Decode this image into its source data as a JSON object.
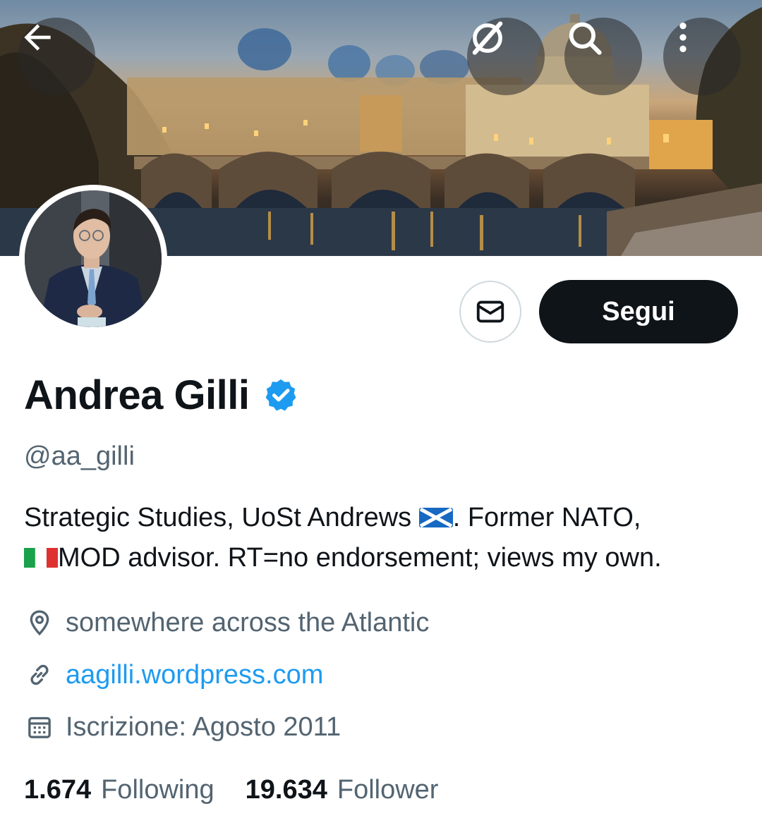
{
  "header": {
    "back_icon": "arrow-left-icon",
    "grok_icon": "slashed-circle-icon",
    "search_icon": "search-icon",
    "more_icon": "more-vertical-icon"
  },
  "profile": {
    "display_name": "Andrea Gilli",
    "verified": true,
    "handle": "@aa_gilli",
    "bio_part1": "Strategic Studies, UoSt Andrews ",
    "bio_part2": ". Former NATO,",
    "bio_part3": "MOD advisor. RT=no endorsement; views my own.",
    "location": "somewhere across the Atlantic",
    "website": "aagilli.wordpress.com",
    "joined": "Iscrizione: Agosto 2011"
  },
  "actions": {
    "follow_label": "Segui"
  },
  "stats": {
    "following_count": "1.674",
    "following_label": "Following",
    "followers_count": "19.634",
    "followers_label": "Follower"
  },
  "colors": {
    "accent": "#1d9bf0",
    "text_primary": "#0f1419",
    "text_secondary": "#536471",
    "button_dark": "#0f1419"
  }
}
